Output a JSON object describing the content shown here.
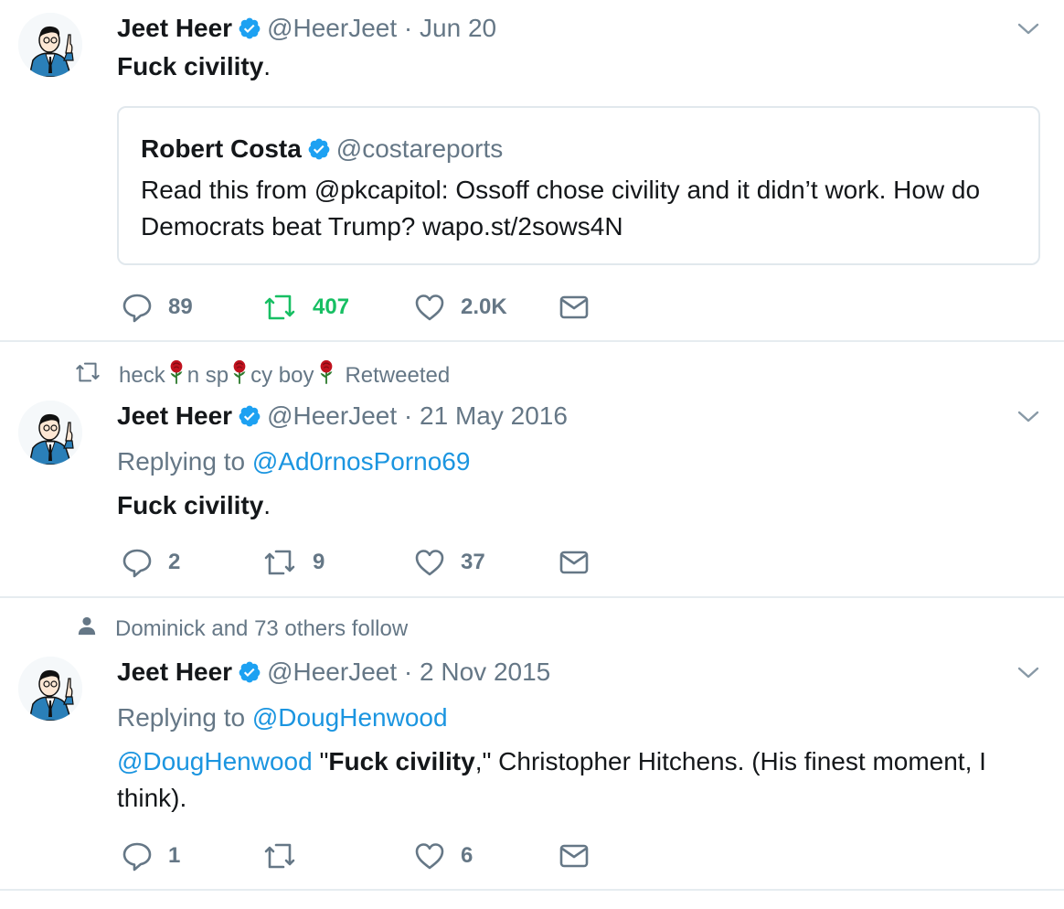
{
  "tweets": [
    {
      "name": "Jeet Heer",
      "handle": "@HeerJeet",
      "dot": "·",
      "date": "Jun 20",
      "text_bold": "Fuck civility",
      "text_after": ".",
      "quote": {
        "name": "Robert Costa",
        "handle": "@costareports",
        "text": "Read this from @pkcapitol: Ossoff chose civility and it didn’t work. How do Democrats beat Trump? wapo.st/2sows4N"
      },
      "replies": "89",
      "retweets": "407",
      "likes": "2.0K"
    },
    {
      "context": {
        "part1": "heck",
        "part2": "n sp",
        "part3": "cy boy",
        "suffix": "Retweeted"
      },
      "name": "Jeet Heer",
      "handle": "@HeerJeet",
      "dot": "·",
      "date": "21 May 2016",
      "replying_label": "Replying to",
      "replying_to": "@Ad0rnosPorno69",
      "text_bold": "Fuck civility",
      "text_after": ".",
      "replies": "2",
      "retweets": "9",
      "likes": "37"
    },
    {
      "context": {
        "text": "Dominick and 73 others follow"
      },
      "name": "Jeet Heer",
      "handle": "@HeerJeet",
      "dot": "·",
      "date": "2 Nov 2015",
      "replying_label": "Replying to",
      "replying_to": "@DougHenwood",
      "text_mention": "@DougHenwood",
      "text_open_quote": " \"",
      "text_bold": "Fuck civility",
      "text_after": ",\" Christopher Hitchens. (His finest moment, I think).",
      "replies": "1",
      "likes": "6"
    }
  ],
  "colors": {
    "text": "#14171a",
    "secondary": "#657786",
    "link": "#1b95e0",
    "retweet_green": "#17bf63",
    "verified": "#1da1f2",
    "rose": "#c0121e",
    "divider": "#e6ecf0"
  },
  "icons": [
    "reply-icon",
    "retweet-icon",
    "like-icon",
    "message-icon",
    "verified-icon",
    "caret-down-icon",
    "rose-icon",
    "person-icon"
  ]
}
